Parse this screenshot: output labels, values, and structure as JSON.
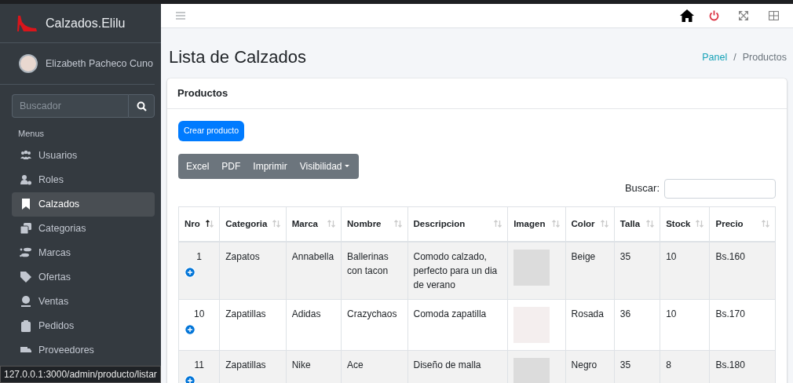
{
  "brand": "Calzados.Elilu",
  "user": {
    "name": "Elizabeth Pacheco Cuno"
  },
  "sidebar_search": {
    "placeholder": "Buscador"
  },
  "sidebar": {
    "header": "Menus",
    "items": [
      {
        "label": "Usuarios",
        "selected": false
      },
      {
        "label": "Roles",
        "selected": false
      },
      {
        "label": "Calzados",
        "selected": true
      },
      {
        "label": "Categorias",
        "selected": false
      },
      {
        "label": "Marcas",
        "selected": false
      },
      {
        "label": "Ofertas",
        "selected": false
      },
      {
        "label": "Ventas",
        "selected": false
      },
      {
        "label": "Pedidos",
        "selected": false
      },
      {
        "label": "Proveedores",
        "selected": false
      }
    ]
  },
  "status_url": "127.0.0.1:3000/admin/producto/listar",
  "page_title": "Lista de Calzados",
  "breadcrumb": {
    "separator": "/",
    "items": [
      {
        "label": "Panel",
        "link": true
      },
      {
        "label": "Productos",
        "link": false
      }
    ]
  },
  "card": {
    "title": "Productos",
    "create_button": "Crear producto",
    "export_buttons": [
      {
        "label": "Excel",
        "dropdown": false
      },
      {
        "label": "PDF",
        "dropdown": false
      },
      {
        "label": "Imprimir",
        "dropdown": false
      },
      {
        "label": "Visibilidad",
        "dropdown": true
      }
    ],
    "search_label": "Buscar:"
  },
  "table": {
    "columns": [
      {
        "label": "Nro",
        "sorted_ascending": true
      },
      {
        "label": "Categoria",
        "sorted_ascending": false
      },
      {
        "label": "Marca",
        "sorted_ascending": false
      },
      {
        "label": "Nombre",
        "sorted_ascending": false
      },
      {
        "label": "Descripcion",
        "sorted_ascending": false
      },
      {
        "label": "Imagen",
        "sorted_ascending": false
      },
      {
        "label": "Color",
        "sorted_ascending": false
      },
      {
        "label": "Talla",
        "sorted_ascending": false
      },
      {
        "label": "Stock",
        "sorted_ascending": false
      },
      {
        "label": "Precio",
        "sorted_ascending": false
      }
    ],
    "rows": [
      {
        "cells": [
          "1",
          "Zapatos",
          "Annabella",
          "Ballerinas con tacon",
          "Comodo calzado, perfecto para un dia de verano",
          "",
          "Beige",
          "35",
          "10",
          "Bs.160"
        ]
      },
      {
        "cells": [
          "10",
          "Zapatillas",
          "Adidas",
          "Crazychaos",
          "Comoda zapatilla",
          "",
          "Rosada",
          "36",
          "10",
          "Bs.170"
        ]
      },
      {
        "cells": [
          "11",
          "Zapatillas",
          "Nike",
          "Ace",
          "Diseño de malla",
          "",
          "Negro",
          "35",
          "8",
          "Bs.180"
        ]
      }
    ]
  }
}
